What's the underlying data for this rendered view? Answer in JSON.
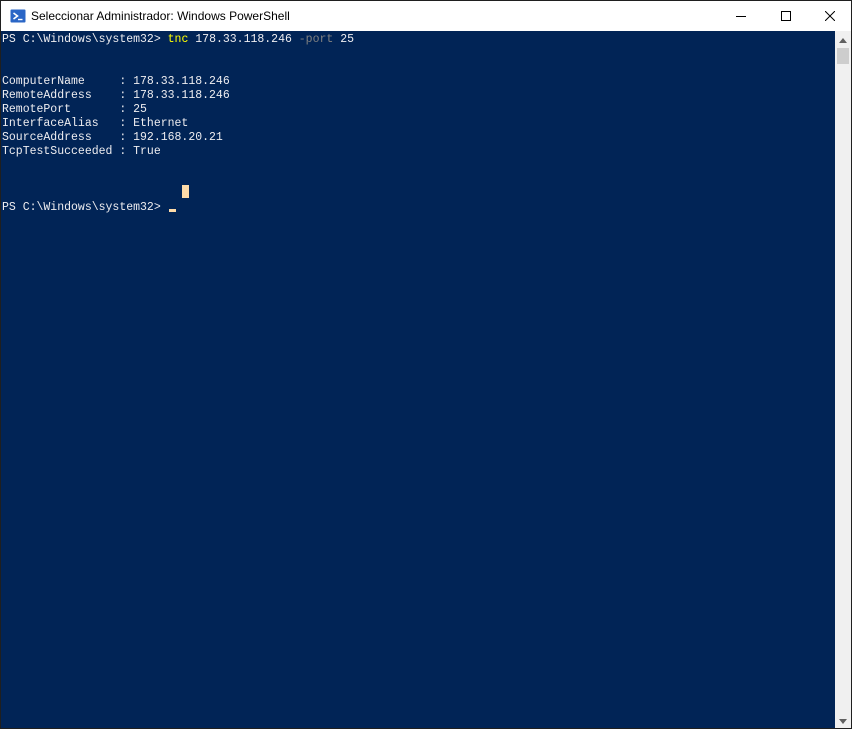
{
  "window": {
    "title": "Seleccionar Administrador: Windows PowerShell",
    "app_icon": "powershell-icon",
    "controls": [
      "minimize-icon",
      "maximize-icon",
      "close-icon"
    ]
  },
  "console": {
    "background_color": "#012456",
    "text_color": "#eeedf0",
    "command": {
      "prompt": "PS C:\\Windows\\system32> ",
      "cmdlet": "tnc",
      "argument": " 178.33.118.246 ",
      "parameter": "-port",
      "value": " 25"
    },
    "output": [
      "ComputerName     : 178.33.118.246",
      "RemoteAddress    : 178.33.118.246",
      "RemotePort       : 25",
      "InterfaceAlias   : Ethernet",
      "SourceAddress    : 192.168.20.21",
      "TcpTestSucceeded : True"
    ],
    "prompt2": "PS C:\\Windows\\system32> "
  }
}
